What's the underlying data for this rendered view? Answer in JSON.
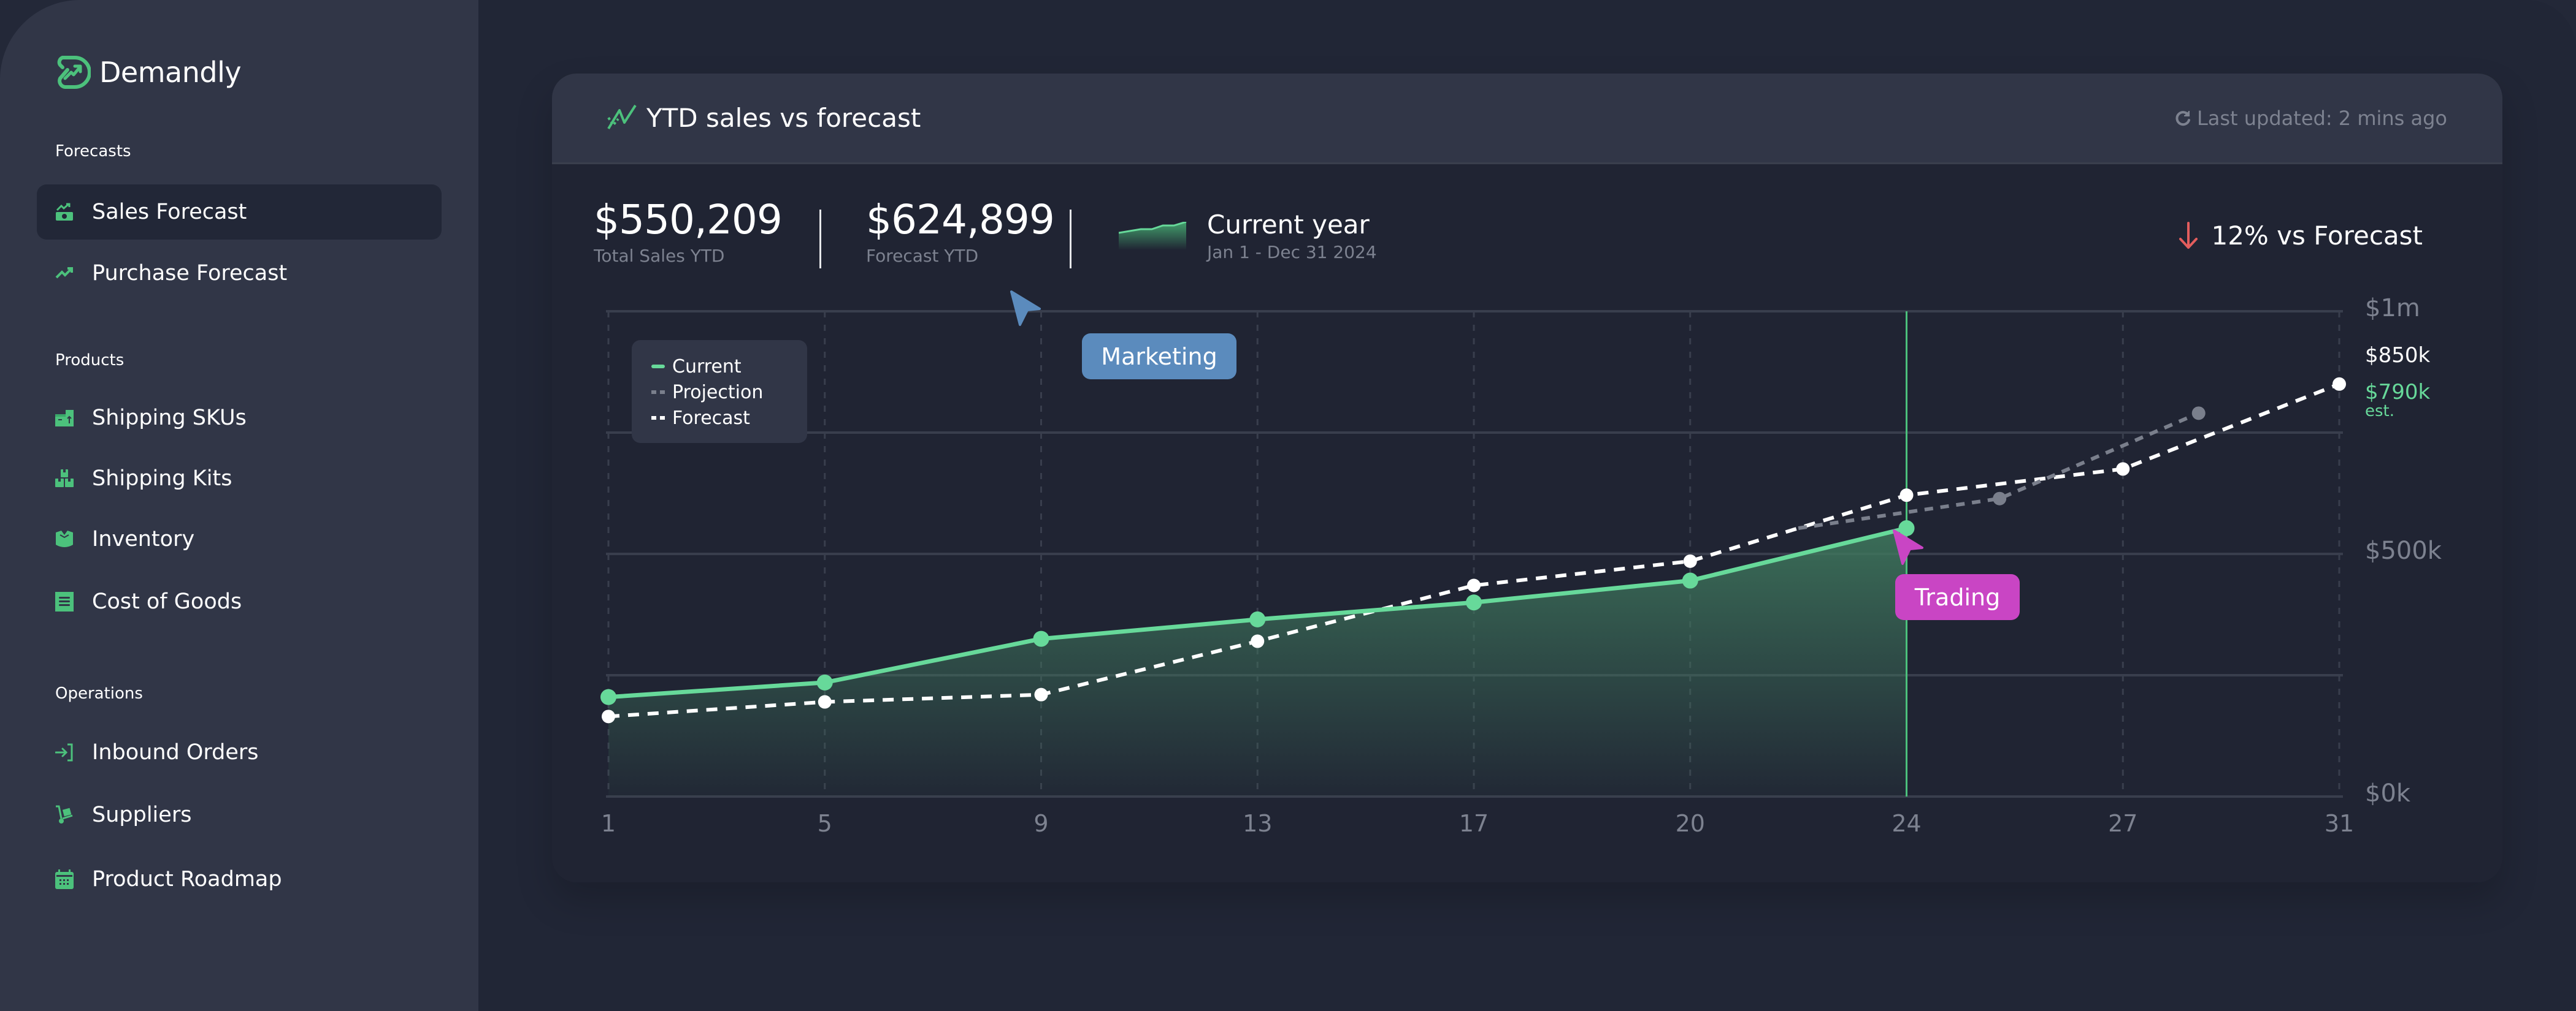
{
  "app": {
    "name": "Demandly",
    "brand_color": "#4cc17c"
  },
  "sidebar": {
    "sections": [
      {
        "label": "Forecasts",
        "items": [
          {
            "label": "Sales Forecast",
            "icon": "money-chart-icon",
            "active": true
          },
          {
            "label": "Purchase Forecast",
            "icon": "trend-up-icon",
            "active": false
          }
        ]
      },
      {
        "label": "Products",
        "items": [
          {
            "label": "Shipping SKUs",
            "icon": "boxes-upload-icon",
            "active": false
          },
          {
            "label": "Shipping Kits",
            "icon": "stacked-boxes-icon",
            "active": false
          },
          {
            "label": "Inventory",
            "icon": "open-box-icon",
            "active": false
          },
          {
            "label": "Cost of Goods",
            "icon": "receipt-icon",
            "active": false
          }
        ]
      },
      {
        "label": "Operations",
        "items": [
          {
            "label": "Inbound Orders",
            "icon": "sign-in-icon",
            "active": false
          },
          {
            "label": "Suppliers",
            "icon": "hand-truck-icon",
            "active": false
          },
          {
            "label": "Product Roadmap",
            "icon": "calendar-icon",
            "active": false
          }
        ]
      }
    ]
  },
  "card": {
    "title": "YTD sales vs forecast",
    "last_updated": "Last updated: 2 mins ago",
    "kpis": [
      {
        "value": "$550,209",
        "label": "Total Sales YTD"
      },
      {
        "value": "$624,899",
        "label": "Forecast YTD"
      }
    ],
    "period": {
      "title": "Current year",
      "range": "Jan 1 - Dec 31 2024"
    },
    "vs_forecast": {
      "text": "12% vs Forecast",
      "direction": "down",
      "color": "#e35d5d"
    },
    "tags": [
      {
        "label": "Marketing",
        "color": "#5b8bbd"
      },
      {
        "label": "Trading",
        "color": "#c945c4"
      }
    ]
  },
  "chart_data": {
    "type": "line",
    "title": "YTD sales vs forecast",
    "categories": [
      "1",
      "5",
      "9",
      "13",
      "17",
      "20",
      "24",
      "27",
      "31"
    ],
    "xlabel": "",
    "ylabel": "",
    "ylim": [
      0,
      1000
    ],
    "y_unit": "$k",
    "y_ticks": [
      {
        "value": 0,
        "label": "$0k"
      },
      {
        "value": 500,
        "label": "$500k"
      },
      {
        "value": 1000,
        "label": "$1m"
      }
    ],
    "gridlines": [
      0,
      250,
      500,
      750,
      1000
    ],
    "grid": true,
    "legend": {
      "placement": "top-left",
      "entries": [
        "Current",
        "Projection",
        "Forecast"
      ]
    },
    "series": [
      {
        "name": "Current",
        "style": "solid-area",
        "color": "#67d99a",
        "values": [
          205,
          235,
          325,
          365,
          400,
          445,
          553,
          null,
          null
        ]
      },
      {
        "name": "Forecast",
        "style": "dashed",
        "color": "#ffffff",
        "values": [
          165,
          195,
          210,
          320,
          435,
          485,
          621,
          675,
          850
        ]
      },
      {
        "name": "Projection",
        "style": "dashed",
        "color": "#7a7f8c",
        "points": [
          {
            "x_index": 5.5,
            "value": 553
          },
          {
            "x_index": 6.43,
            "value": 614
          },
          {
            "x_index": 7.35,
            "value": 790
          }
        ]
      }
    ],
    "current_marker": {
      "category": "24",
      "color": "#4cc17c"
    },
    "annotations": [
      {
        "text": "$850k",
        "series": "Forecast",
        "color": "#ffffff"
      },
      {
        "text": "$790k",
        "sub": "est.",
        "series": "Projection",
        "color": "#67d99a"
      }
    ]
  }
}
